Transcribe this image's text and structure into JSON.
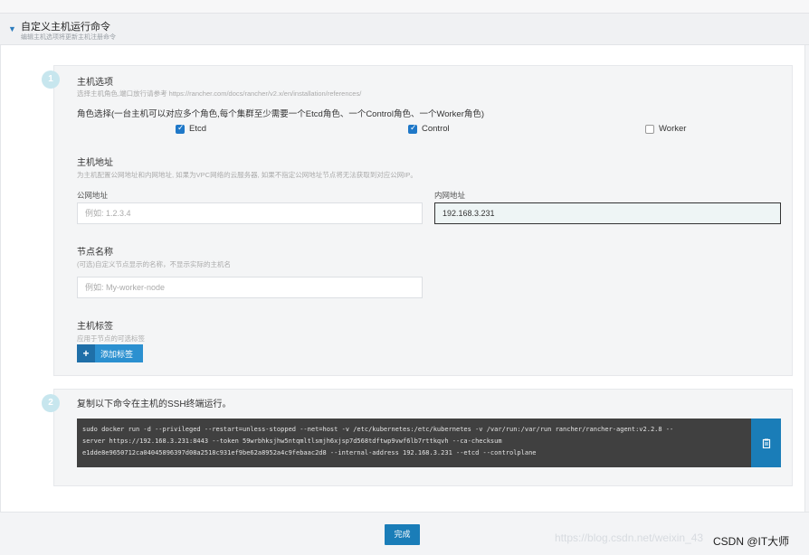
{
  "header": {
    "title": "自定义主机运行命令",
    "subtitle": "编辑主机选项将更新主机注册命令"
  },
  "step1": {
    "number": "1",
    "host_options_title": "主机选项",
    "host_options_help": "选择主机角色,端口放行请参考 https://rancher.com/docs/rancher/v2.x/en/installation/references/",
    "roles_label": "角色选择(一台主机可以对应多个角色,每个集群至少需要一个Etcd角色、一个Control角色、一个Worker角色)",
    "roles": [
      {
        "label": "Etcd",
        "checked": true
      },
      {
        "label": "Control",
        "checked": true
      },
      {
        "label": "Worker",
        "checked": false
      }
    ],
    "address_title": "主机地址",
    "address_help": "为主机配置公网地址和内网地址, 如果为VPC网络的云服务器, 如果不指定公网地址节点将无法获取到对应公网IP。",
    "public_label": "公网地址",
    "public_placeholder": "例如: 1.2.3.4",
    "private_label": "内网地址",
    "private_value": "192.168.3.231",
    "node_name_title": "节点名称",
    "node_name_help": "(可选)自定义节点显示的名称，不显示实际的主机名",
    "node_name_placeholder": "例如: My-worker-node",
    "labels_title": "主机标签",
    "labels_help": "应用于节点的可选标签",
    "add_label_button": "添加标签"
  },
  "step2": {
    "number": "2",
    "title": "复制以下命令在主机的SSH终端运行。",
    "command_lines": [
      "sudo docker run -d --privileged --restart=unless-stopped --net=host -v /etc/kubernetes:/etc/kubernetes -v /var/run:/var/run rancher/rancher-agent:v2.2.8 --",
      "server https://192.168.3.231:8443 --token 59wrbhksjhw5ntqmltlsmjh6xjsp7d568tdftwp9vwf6lb7rttkqvh --ca-checksum",
      "e1dde8e9650712ca04045896397d08a2518c931ef9be62a8952a4c9febaac2d8 --internal-address 192.168.3.231 --etcd --controlplane"
    ]
  },
  "footer": {
    "done_button": "完成"
  },
  "watermark": {
    "faint": "https://blog.csdn.net/weixin_43",
    "strong": "CSDN @IT大师"
  },
  "colors": {
    "primary": "#1a7db8",
    "checkbox": "#1f78c8",
    "command_bg": "#404040"
  },
  "icons": {
    "caret": "caret-down-icon",
    "plus": "plus-icon",
    "copy": "clipboard-icon"
  }
}
